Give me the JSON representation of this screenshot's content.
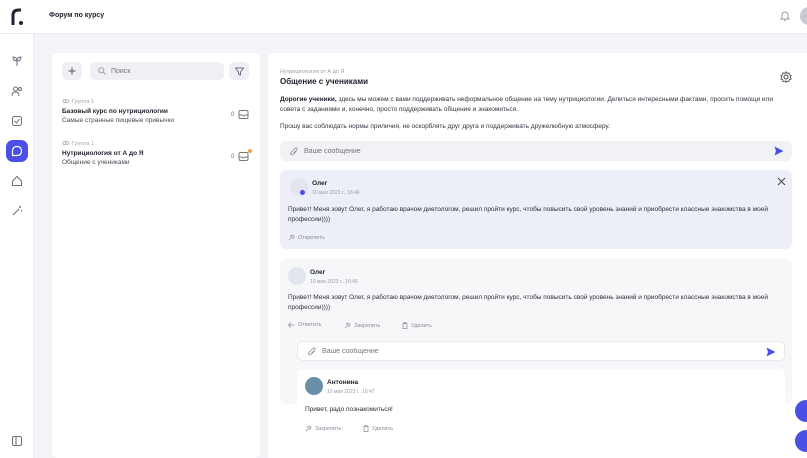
{
  "header": {
    "title": "Форум по курсу"
  },
  "sidebar_icons": [
    "plant-icon",
    "community-icon",
    "checklist-icon",
    "chat-icon",
    "home-icon",
    "magic-icon",
    "collapse-icon"
  ],
  "forum_list": {
    "search_placeholder": "Поиск",
    "items": [
      {
        "group": "Группа 1",
        "title": "Базовый курс по нутрициологии",
        "subtitle": "Самые странные пищевые привычки",
        "count": "0"
      },
      {
        "group": "Группа 1",
        "title": "Нутрициология от А до Я",
        "subtitle": "Общение с учениками",
        "count": "0"
      }
    ]
  },
  "topic": {
    "breadcrumb": "Нутрициология от А до Я",
    "title": "Общение с учениками",
    "intro_bold": "Дорогие ученики,",
    "intro_rest": " здесь мы можем с вами поддерживать неформальное общение на тему нутрициологии. Делиться интересными фактами, просить помощи или совета с заданиями и, конечно, просто поддерживать общение и знакомиться.",
    "rules": "Прошу вас соблюдать нормы приличия, не оскорблять друг друга и поддерживать дружелюбную атмосферу.",
    "composer_placeholder": "Ваше сообщение"
  },
  "messages": [
    {
      "author": "Олег",
      "date": "10 мая 2023 г., 16:46",
      "text": "Привет! Меня зовут Олег, я работаю врачом диетологом, решил пройти курс, чтобы повысить свой уровень знаний и приобрести классные знакомства в моей профессии))))",
      "action_pin": "Открепить"
    },
    {
      "author": "Олег",
      "date": "10 мая 2023 г., 16:46",
      "text": "Привет! Меня зовут Олег, я работаю врачом диетологом, решил пройти курс, чтобы повысить свой уровень знаний и приобрести классные знакомства в моей профессии))))",
      "action_reply": "Ответить",
      "action_pin": "Закрепить",
      "action_delete": "Удалить",
      "reply_placeholder": "Ваше сообщение",
      "reply": {
        "author": "Антонина",
        "date": "10 мая 2023 г., 16:47",
        "text": "Привет, радо познакомиться!",
        "action_pin": "Закрепить",
        "action_delete": "Удалить"
      }
    }
  ],
  "colors": {
    "accent": "#4a4fe6",
    "badge": "#f0a53a"
  }
}
